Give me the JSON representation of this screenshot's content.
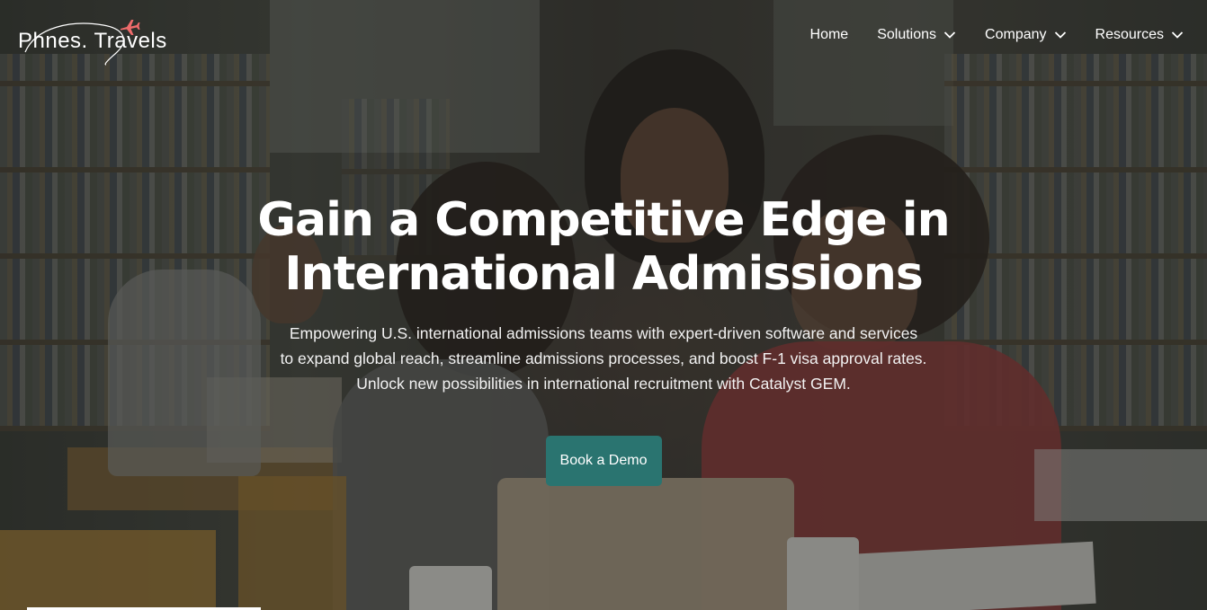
{
  "brand": {
    "logo_text": "Phnes. Travels",
    "accent_color": "#ef6b6b"
  },
  "nav": {
    "items": [
      {
        "label": "Home",
        "has_dropdown": false
      },
      {
        "label": "Solutions",
        "has_dropdown": true
      },
      {
        "label": "Company",
        "has_dropdown": true
      },
      {
        "label": "Resources",
        "has_dropdown": true
      }
    ]
  },
  "hero": {
    "headline_line1": "Gain a Competitive Edge in",
    "headline_line2": "International Admissions",
    "sub_line1": "Empowering U.S. international admissions teams with expert-driven software and services",
    "sub_line2": "to expand global reach, streamline admissions processes, and boost F-1 visa approval rates.",
    "sub_line3": "Unlock new possibilities in international recruitment with Catalyst GEM.",
    "cta_label": "Book a Demo",
    "cta_color": "#2a7470"
  },
  "icons": {
    "plane": "airplane-icon",
    "dropdown": "chevron-down-icon"
  }
}
